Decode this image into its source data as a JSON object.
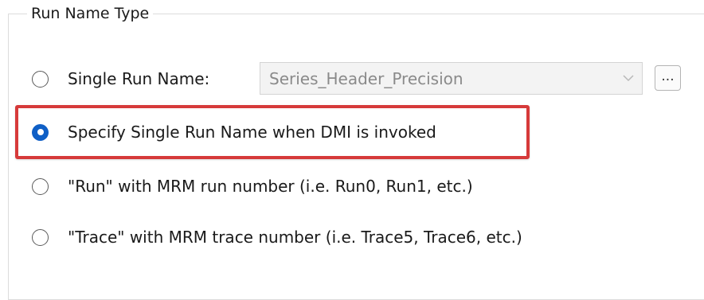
{
  "group": {
    "title": "Run Name Type"
  },
  "options": [
    {
      "label": "Single Run Name:",
      "checked": false
    },
    {
      "label": "Specify Single Run Name when DMI is invoked",
      "checked": true
    },
    {
      "label": "\"Run\" with MRM run number (i.e. Run0, Run1, etc.)",
      "checked": false
    },
    {
      "label": "\"Trace\" with MRM trace number (i.e. Trace5, Trace6, etc.)",
      "checked": false
    }
  ],
  "run_name_combo": {
    "value": "Series_Header_Precision",
    "enabled": false
  },
  "browse_button": {
    "label": "..."
  },
  "colors": {
    "radio_checked": "#0f5fc6",
    "highlight_border": "#d63a3a",
    "disabled_text": "#8a8a8a"
  },
  "icons": {
    "combo_arrow": "chevron-down-icon"
  }
}
